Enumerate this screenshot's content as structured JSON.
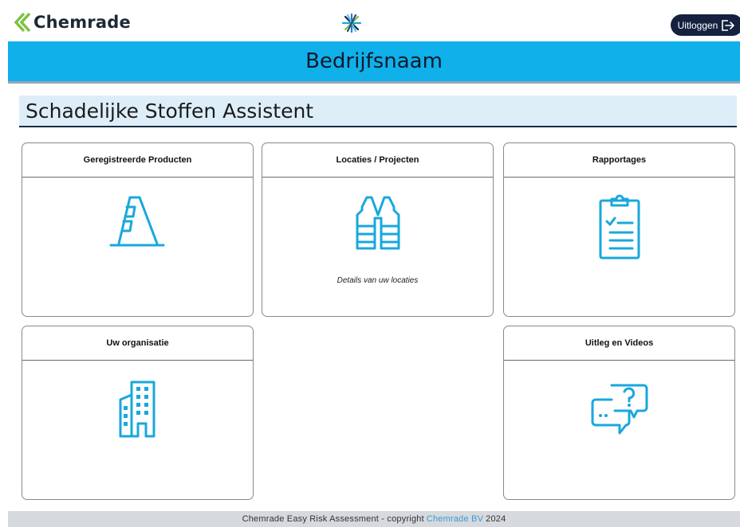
{
  "header": {
    "logo_text": "Chemrade",
    "logout_label": "Uitloggen"
  },
  "banner": {
    "title": "Bedrijfsnaam"
  },
  "main": {
    "page_title": "Schadelijke Stoffen Assistent",
    "cards": [
      {
        "title": "Geregistreerde Producten",
        "icon": "ladder-icon",
        "description": ""
      },
      {
        "title": "Locaties / Projecten",
        "icon": "safety-vest-icon",
        "description": "Details van uw locaties"
      },
      {
        "title": "Rapportages",
        "icon": "clipboard-checklist-icon",
        "description": ""
      },
      {
        "title": "Uw organisatie",
        "icon": "building-icon",
        "description": ""
      },
      {
        "title": "Uitleg en Videos",
        "icon": "chat-question-icon",
        "description": ""
      }
    ]
  },
  "footer": {
    "prefix": "Chemrade Easy Risk Assessment - copyright",
    "link_text": "Chemrade BV",
    "year": "2024"
  },
  "colors": {
    "banner": "#10b0ea",
    "accent_icon": "#18a8dc",
    "logout_button": "#14213f",
    "logo_green": "#7dc242"
  }
}
